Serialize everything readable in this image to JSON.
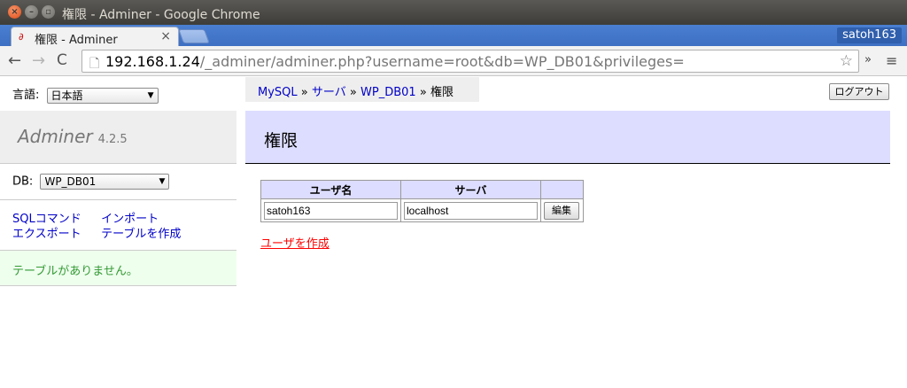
{
  "window": {
    "title": "権限 - Adminer - Google Chrome",
    "close_glyph": "×",
    "min_glyph": "–",
    "max_glyph": "▫"
  },
  "tabs": {
    "active_title": "権限 - Adminer",
    "close_glyph": "×",
    "favicon": "adminer-favicon",
    "profile_name": "satoh163"
  },
  "toolbar": {
    "back_glyph": "←",
    "forward_glyph": "→",
    "reload_glyph": "C",
    "url_host": "192.168.1.24",
    "url_path": "/_adminer/adminer.php?username=root&db=WP_DB01&privileges=",
    "star_glyph": "☆",
    "extensions_glyph": "»",
    "menu_glyph": "≡"
  },
  "sidebar": {
    "language_label": "言語:",
    "language_value": "日本語",
    "logo_text": "Adminer",
    "version": "4.2.5",
    "db_label": "DB:",
    "db_value": "WP_DB01",
    "links": {
      "sql_command": "SQLコマンド",
      "import": "インポート",
      "export": "エクスポート",
      "create_table": "テーブルを作成"
    },
    "message": "テーブルがありません。"
  },
  "breadcrumb": {
    "mysql": "MySQL",
    "sep": "»",
    "server": "サーバ",
    "db": "WP_DB01",
    "current": "権限"
  },
  "header": {
    "logout_label": "ログアウト",
    "page_title": "権限"
  },
  "privileges": {
    "columns": [
      "ユーザ名",
      "サーバ"
    ],
    "rows": [
      {
        "user": "satoh163",
        "server": "localhost",
        "edit_label": "編集"
      }
    ],
    "create_user_link": "ユーザを作成"
  }
}
